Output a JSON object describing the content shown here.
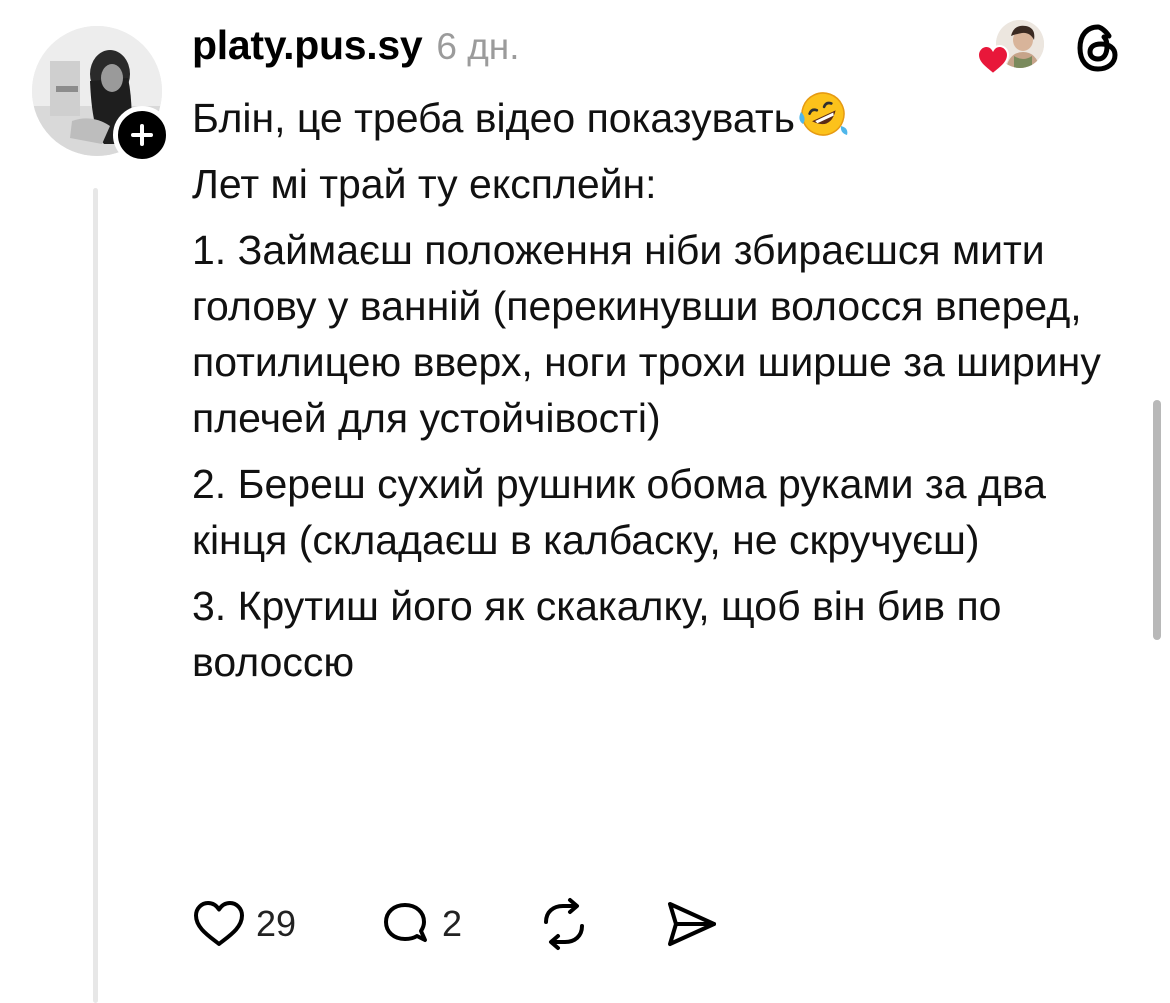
{
  "post": {
    "username": "platy.pus.sy",
    "timestamp": "6 дн.",
    "paragraphs": [
      "Блін, це треба відео показувать",
      "Лет мі трай ту експлейн:",
      "1. Займаєш положення ніби збираєшся мити голову у ванній (перекинувши волосся вперед, потилицею вверх, ноги трохи ширше за ширину плечей для устойчівості)",
      "2. Береш сухий рушник обома руками за два кінця (складаєш в калбаску, не скручуєш)",
      "3. Крутиш його як скакалку, щоб він бив по волоссю"
    ],
    "emoji": "rolling-on-floor-laughing",
    "liked_by_author": true,
    "likes": "29",
    "replies": "2"
  },
  "icons": {
    "follow": "plus-icon",
    "app": "threads-logo-icon",
    "like": "heart-outline-icon",
    "reply": "speech-bubble-icon",
    "repost": "repost-icon",
    "share": "send-icon",
    "liked": "red-heart-icon"
  },
  "colors": {
    "text": "#111111",
    "timestamp": "#9b9b9b",
    "heart": "#e8173a",
    "thread_line": "#e7e7e7"
  }
}
